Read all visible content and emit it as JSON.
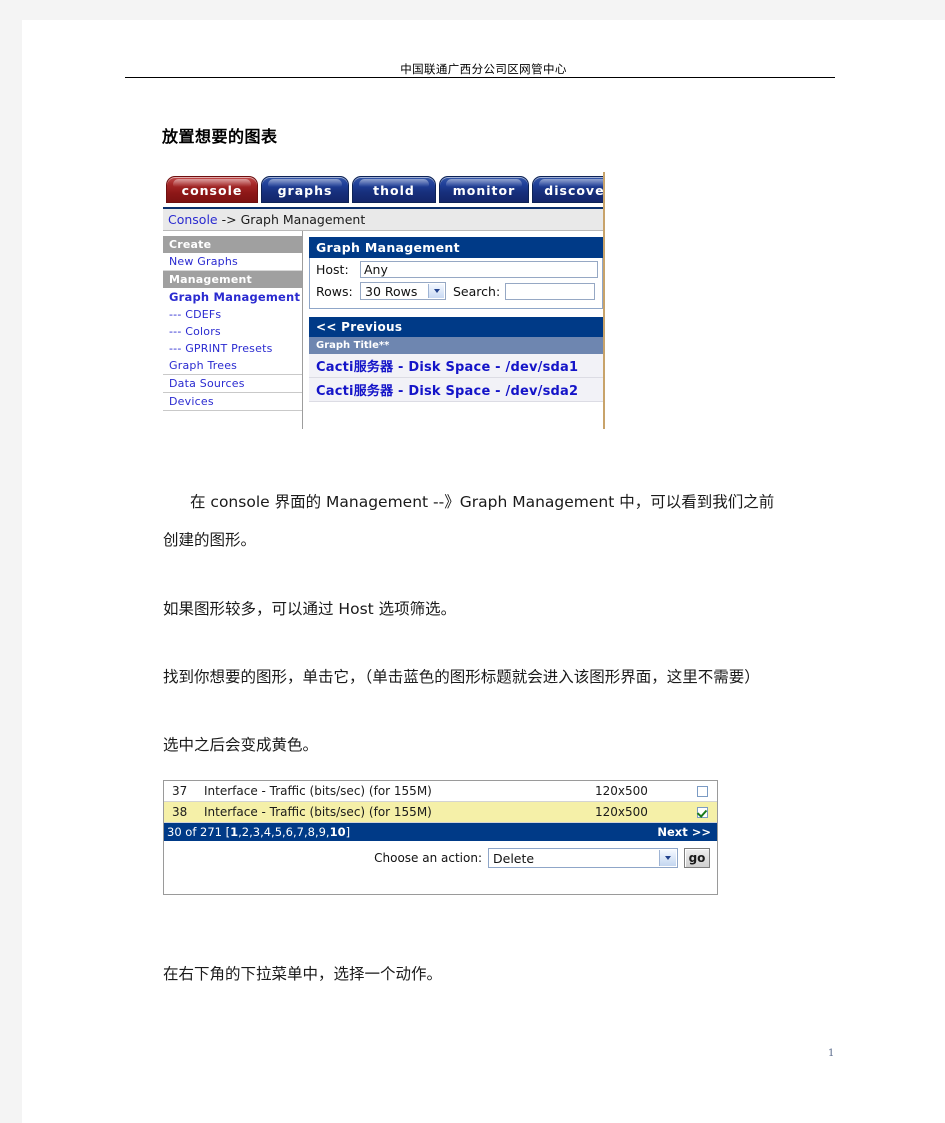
{
  "document": {
    "running_header": "中国联通广西分公司区网管中心",
    "heading": "放置想要的图表",
    "page_number": "1",
    "paragraphs": [
      "在 console 界面的 Management --》Graph Management 中，可以看到我们之前",
      "创建的图形。",
      "如果图形较多，可以通过 Host 选项筛选。",
      "找到你想要的图形，单击它，（单击蓝色的图形标题就会进入该图形界面，这里不需要）",
      "选中之后会变成黄色。",
      "在右下角的下拉菜单中，选择一个动作。"
    ]
  },
  "screenshot1": {
    "tabs": [
      {
        "label": "console",
        "active": true
      },
      {
        "label": "graphs",
        "active": false
      },
      {
        "label": "thold",
        "active": false
      },
      {
        "label": "monitor",
        "active": false
      },
      {
        "label": "discover",
        "active": false
      }
    ],
    "breadcrumb": {
      "link": "Console",
      "separator": " -> ",
      "current": "Graph Management"
    },
    "sidebar": [
      {
        "label": "Create",
        "type": "header"
      },
      {
        "label": "New Graphs",
        "type": "link"
      },
      {
        "label": "Management",
        "type": "header"
      },
      {
        "label": "Graph Management",
        "type": "selected"
      },
      {
        "label": "--- CDEFs",
        "type": "sub"
      },
      {
        "label": "--- Colors",
        "type": "sub"
      },
      {
        "label": "--- GPRINT Presets",
        "type": "sub"
      },
      {
        "label": "Graph Trees",
        "type": "plain"
      },
      {
        "label": "Data Sources",
        "type": "plain"
      },
      {
        "label": "Devices",
        "type": "plain"
      }
    ],
    "panel": {
      "title": "Graph Management",
      "host_label": "Host:",
      "host_value": "Any",
      "rows_label": "Rows:",
      "rows_value": "30 Rows",
      "search_label": "Search:",
      "search_value": "",
      "previous_label": "<< Previous",
      "column_header": "Graph Title**",
      "graph_rows": [
        "Cacti服务器 - Disk Space - /dev/sda1",
        "Cacti服务器 - Disk Space - /dev/sda2"
      ]
    },
    "colors": {
      "panel_header_blue": "#003a87",
      "active_tab_red": "#a52727",
      "tab_blue": "#20409a",
      "column_header_blue": "#6e86b0"
    }
  },
  "screenshot2": {
    "rows": [
      {
        "id": "37",
        "title": "Interface - Traffic (bits/sec) (for 155M)",
        "size": "120x500",
        "checked": false,
        "selected": false
      },
      {
        "id": "38",
        "title": "Interface - Traffic (bits/sec) (for 155M)",
        "size": "120x500",
        "checked": true,
        "selected": true
      }
    ],
    "pager": {
      "summary": "30 of 271 [",
      "current_page": "1",
      "pages_rest": ",2,3,4,5,6,7,8,9,",
      "last_page": "10",
      "closing": "]",
      "next_label": "Next >>"
    },
    "action": {
      "label": "Choose an action:",
      "selected": "Delete",
      "go_label": "go"
    },
    "colors": {
      "selected_row_yellow": "#f5f0a8",
      "pager_blue": "#003a87",
      "check_green": "#1a7a1a"
    }
  }
}
